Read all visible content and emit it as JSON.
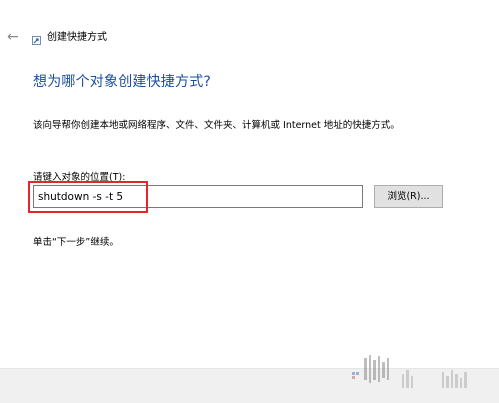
{
  "header": {
    "back_icon": "back-arrow-icon",
    "app_icon": "shortcut-icon",
    "title": "创建快捷方式"
  },
  "main": {
    "heading": "想为哪个对象创建快捷方式?",
    "description": "该向导帮你创建本地或网络程序、文件、文件夹、计算机或 Internet 地址的快捷方式。",
    "location_label": "请键入对象的位置(T):",
    "location_value": "shutdown -s -t 5",
    "browse_label": "浏览(R)...",
    "hint": "单击“下一步”继续。"
  },
  "colors": {
    "heading": "#1a4f9c",
    "highlight": "#e2262a",
    "footer": "#f0f0f0"
  }
}
